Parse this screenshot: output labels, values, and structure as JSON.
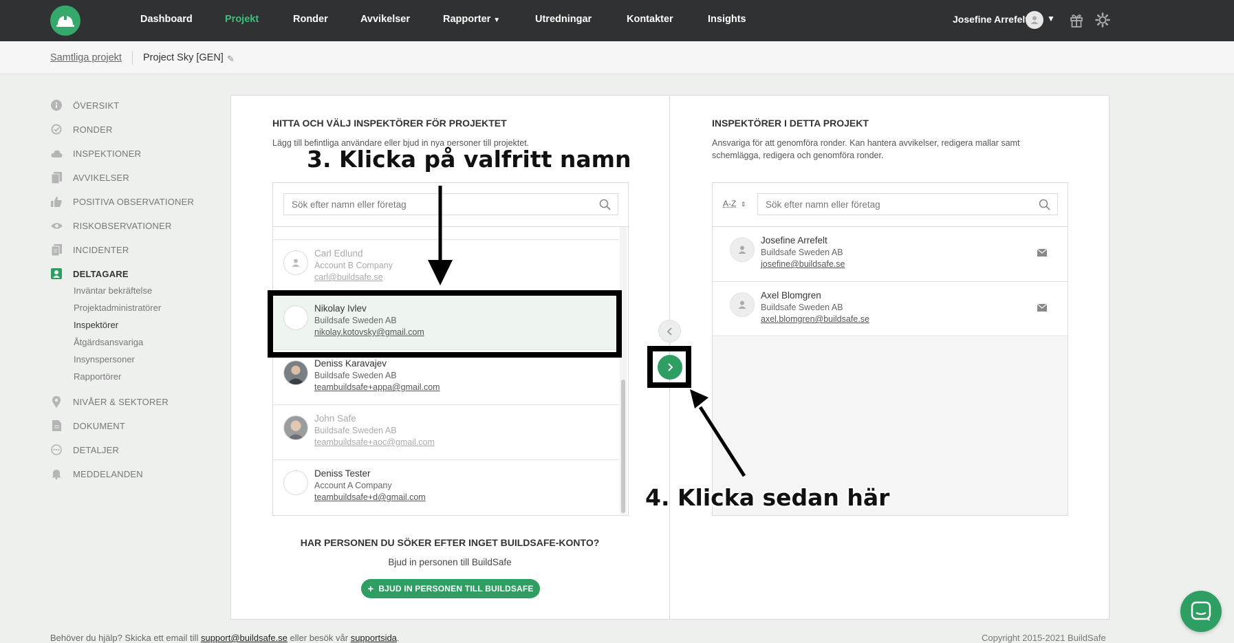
{
  "nav": {
    "items": [
      "Dashboard",
      "Projekt",
      "Ronder",
      "Avvikelser",
      "Rapporter",
      "Utredningar",
      "Kontakter",
      "Insights"
    ],
    "active": "Projekt",
    "user_name": "Josefine Arrefelt",
    "accent": "#3fbf7f"
  },
  "breadcrumb": {
    "all_projects": "Samtliga projekt",
    "current": "Project Sky [GEN]"
  },
  "sidebar": {
    "items": [
      {
        "label": "ÖVERSIKT",
        "icon": "info-icon"
      },
      {
        "label": "RONDER",
        "icon": "check-circle-icon"
      },
      {
        "label": "INSPEKTIONER",
        "icon": "cloud-icon"
      },
      {
        "label": "AVVIKELSER",
        "icon": "document-icon"
      },
      {
        "label": "POSITIVA OBSERVATIONER",
        "icon": "thumbs-up-icon"
      },
      {
        "label": "RISKOBSERVATIONER",
        "icon": "eye-icon"
      },
      {
        "label": "INCIDENTER",
        "icon": "clipboard-icon"
      },
      {
        "label": "DELTAGARE",
        "icon": "person-icon"
      },
      {
        "label": "NIVÅER & SEKTORER",
        "icon": "location-pin-icon"
      },
      {
        "label": "DOKUMENT",
        "icon": "file-icon"
      },
      {
        "label": "DETALJER",
        "icon": "more-icon"
      },
      {
        "label": "MEDDELANDEN",
        "icon": "bell-icon"
      }
    ],
    "sub_items": [
      "Inväntar bekräftelse",
      "Projektadministratörer",
      "Inspektörer",
      "Åtgärdsansvariga",
      "Insynspersoner",
      "Rapportörer"
    ],
    "active_sub": "Inspektörer"
  },
  "left_panel": {
    "title": "HITTA OCH VÄLJ INSPEKTÖRER FÖR PROJEKTET",
    "description": "Lägg till befintliga användare eller bjud in nya personer till projektet.",
    "search_placeholder": "Sök efter namn eller företag",
    "people": [
      {
        "name": "Carl Edlund",
        "company": "Account B Company",
        "email": "carl@buildsafe.se",
        "state": "dim"
      },
      {
        "name": "Nikolay Ivlev",
        "company": "Buildsafe Sweden AB",
        "email": "nikolay.kotovsky@gmail.com",
        "state": "selected"
      },
      {
        "name": "Deniss Karavajev",
        "company": "Buildsafe Sweden AB",
        "email": "teambuildsafe+appa@gmail.com",
        "state": "normal"
      },
      {
        "name": "John Safe",
        "company": "Buildsafe Sweden AB",
        "email": "teambuildsafe+aoc@gmail.com",
        "state": "dim"
      },
      {
        "name": "Deniss Tester",
        "company": "Account A Company",
        "email": "teambuildsafe+d@gmail.com",
        "state": "normal"
      }
    ]
  },
  "right_panel": {
    "title": "INSPEKTÖRER I DETTA PROJEKT",
    "description": "Ansvariga för att genomföra ronder. Kan hantera avvikelser, redigera mallar samt schemlägga, redigera och genomföra ronder.",
    "sort_label": "A-Z",
    "search_placeholder": "Sök efter namn eller företag",
    "people": [
      {
        "name": "Josefine Arrefelt",
        "company": "Buildsafe Sweden AB",
        "email": "josefine@buildsafe.se"
      },
      {
        "name": "Axel Blomgren",
        "company": "Buildsafe Sweden AB",
        "email": "axel.blomgren@buildsafe.se"
      }
    ]
  },
  "invite": {
    "question": "HAR PERSONEN DU SÖKER EFTER INGET BUILDSAFE-KONTO?",
    "subtitle": "Bjud in personen till BuildSafe",
    "button_label": "BJUD IN PERSONEN TILL BUILDSAFE"
  },
  "footer": {
    "help_prefix": "Behöver du hjälp? Skicka ett email till",
    "help_email": "support@buildsafe.se",
    "help_middle": "eller besök vår",
    "help_link": "supportsida",
    "help_suffix": ".",
    "copyright": "Copyright 2015-2021 BuildSafe"
  },
  "annotations": {
    "step3": "3. Klicka på valfritt namn",
    "step4": "4. Klicka sedan här"
  },
  "colors": {
    "brand_green": "#2e9e62",
    "nav_bg": "#2f3133",
    "selected_row": "#edf5ee"
  }
}
